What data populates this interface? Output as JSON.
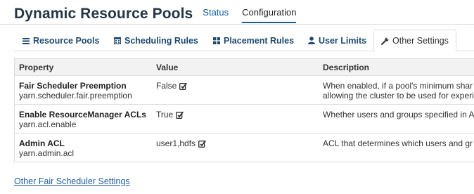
{
  "header": {
    "title": "Dynamic Resource Pools",
    "nav": [
      {
        "label": "Status"
      },
      {
        "label": "Configuration"
      }
    ]
  },
  "tabs": [
    {
      "label": "Resource Pools",
      "icon": "list-icon"
    },
    {
      "label": "Scheduling Rules",
      "icon": "calendar-icon"
    },
    {
      "label": "Placement Rules",
      "icon": "grid-icon"
    },
    {
      "label": "User Limits",
      "icon": "user-icon"
    },
    {
      "label": "Other Settings",
      "icon": "wrench-icon",
      "active": true
    }
  ],
  "table": {
    "columns": [
      "Property",
      "Value",
      "Description"
    ],
    "rows": [
      {
        "name": "Fair Scheduler Preemption",
        "key": "yarn.scheduler.fair.preemption",
        "value": "False",
        "description_line1": "When enabled, if a pool's minimum shar",
        "description_line2": "allowing the cluster to be used for experi"
      },
      {
        "name": "Enable ResourceManager ACLs",
        "key": "yarn.acl.enable",
        "value": "True",
        "description_line1": "Whether users and groups specified in A",
        "description_line2": ""
      },
      {
        "name": "Admin ACL",
        "key": "yarn.admin.acl",
        "value": "user1,hdfs",
        "description_line1": "ACL that determines which users and gr",
        "description_line2": ""
      }
    ]
  },
  "footer": {
    "link": "Other Fair Scheduler Settings"
  },
  "colors": {
    "title": "#253746",
    "link": "#1f5f9a",
    "tab_text": "#1f4a6e",
    "border": "#dddddd",
    "header_bg": "#f2f2f2"
  }
}
